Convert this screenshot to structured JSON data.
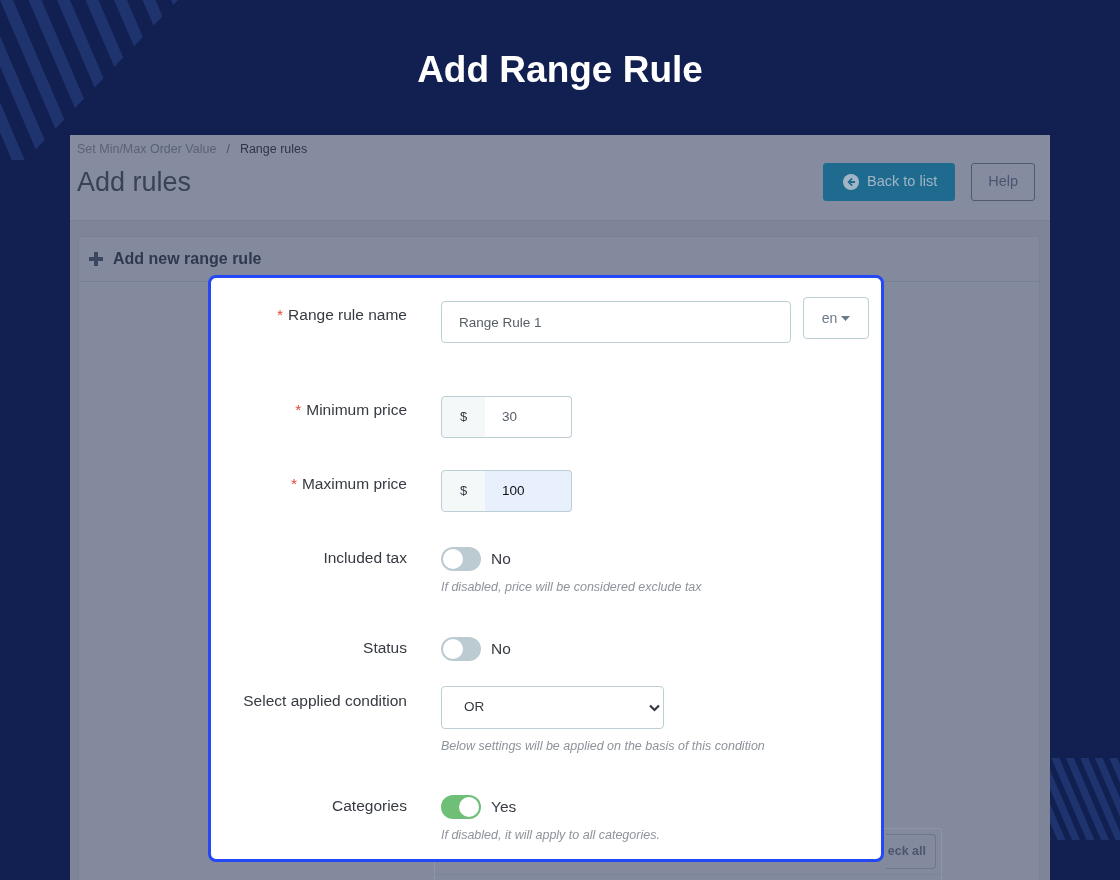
{
  "banner": {
    "title": "Add Range Rule"
  },
  "admin_page": {
    "breadcrumb": {
      "items": [
        {
          "label": "Set Min/Max Order Value",
          "current": false
        },
        {
          "label": "Range rules",
          "current": true
        }
      ],
      "separator": "/"
    },
    "title": "Add rules",
    "buttons": [
      {
        "kind": "primary",
        "label": "Back to list"
      },
      {
        "kind": "outline",
        "label": "Help"
      }
    ],
    "card": {
      "title": "Add new range rule",
      "partial_button": "eck all"
    }
  },
  "dialog": {
    "required_mark": "*",
    "fields": [
      {
        "kind": "text",
        "label": "Range rule name",
        "required": true,
        "value": "Range Rule 1",
        "language": "en"
      },
      {
        "kind": "price",
        "label": "Minimum price",
        "required": true,
        "prefix": "$",
        "value": "30",
        "highlighted": false
      },
      {
        "kind": "price",
        "label": "Maximum price",
        "required": true,
        "prefix": "$",
        "value": "100",
        "highlighted": true
      },
      {
        "kind": "switch",
        "label": "Included tax",
        "required": false,
        "on": false,
        "state_label": "No",
        "help": "If disabled, price will be considered exclude tax"
      },
      {
        "kind": "switch",
        "label": "Status",
        "required": false,
        "on": false,
        "state_label": "No"
      },
      {
        "kind": "select",
        "label": "Select applied condition",
        "required": false,
        "value": "OR",
        "help": "Below settings will be applied on the basis of this condition"
      },
      {
        "kind": "switch",
        "label": "Categories",
        "required": false,
        "on": true,
        "state_label": "Yes",
        "help": "If disabled, it will apply to all categories."
      }
    ]
  }
}
